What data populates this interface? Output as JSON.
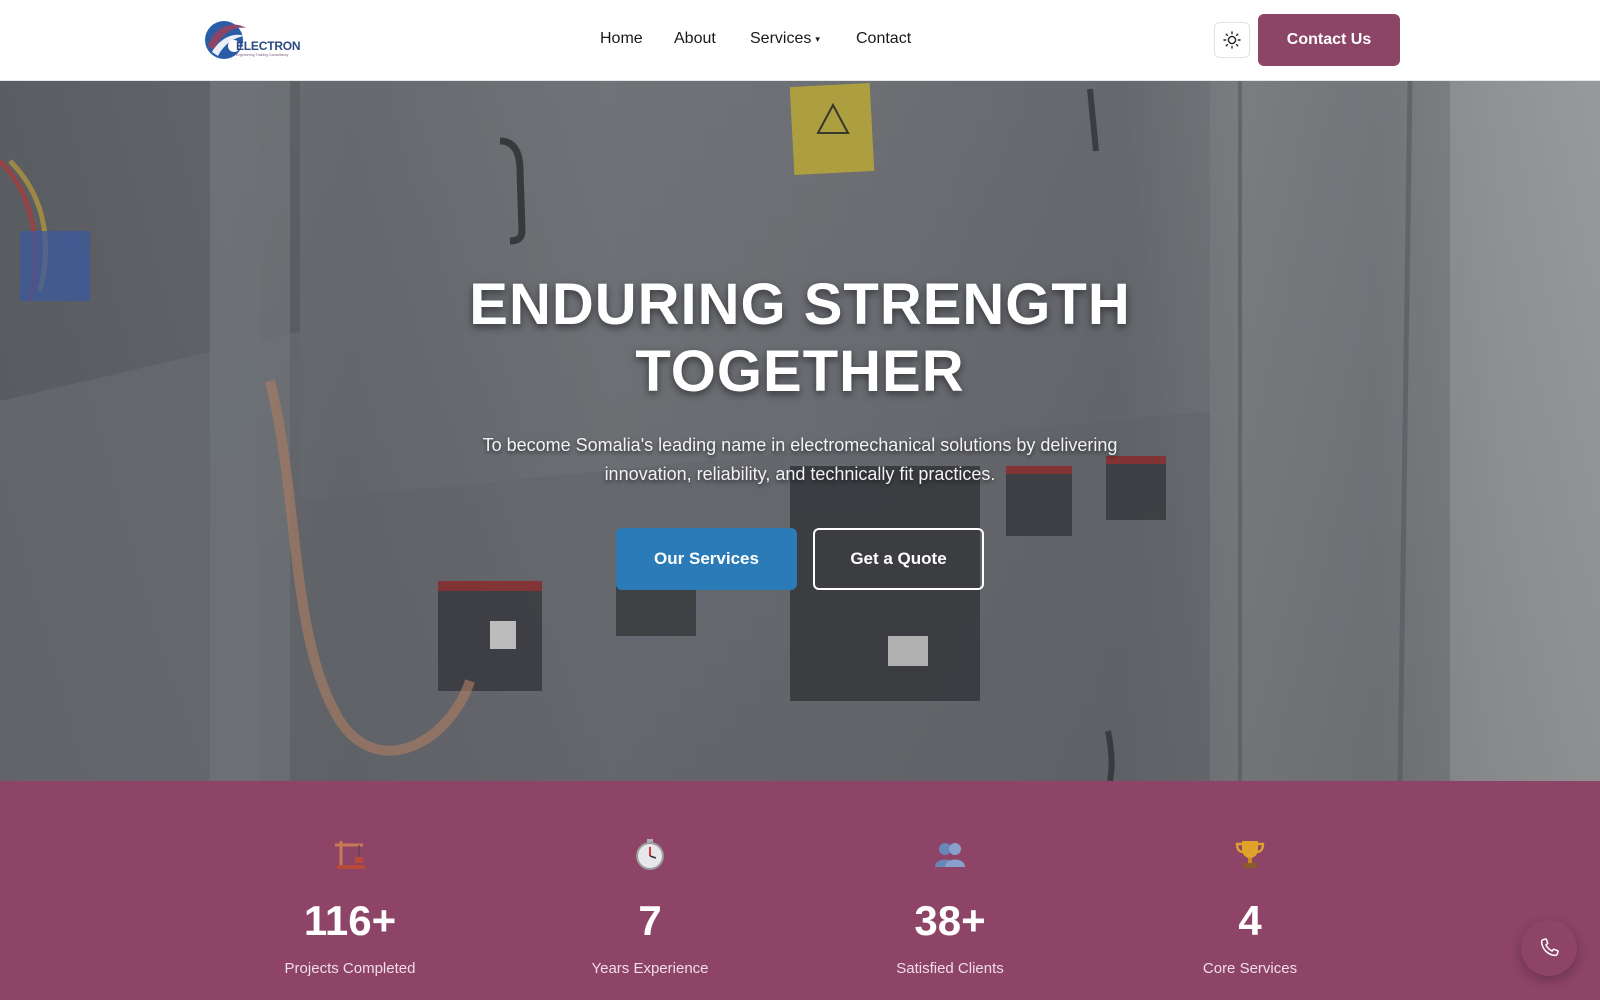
{
  "brand": {
    "name": "ELECTRON",
    "tagline": "Engineering Training Consultancy",
    "colors": {
      "primary": "#8c4467",
      "accent_blue": "#2b7bb9"
    }
  },
  "nav": {
    "items": [
      {
        "label": "Home"
      },
      {
        "label": "About"
      },
      {
        "label": "Services",
        "has_dropdown": true,
        "caret": "▾"
      },
      {
        "label": "Contact"
      }
    ],
    "theme_toggle_icon": "sun-icon",
    "cta_label": "Contact Us"
  },
  "hero": {
    "title": "ENDURING STRENGTH TOGETHER",
    "subtitle": "To become Somalia's leading name in electromechanical solutions by delivering innovation, reliability, and technically fit practices.",
    "primary_button": "Our Services",
    "secondary_button": "Get a Quote"
  },
  "stats": [
    {
      "icon": "construction-crane-icon",
      "value": "116+",
      "label": "Projects Completed"
    },
    {
      "icon": "stopwatch-icon",
      "value": "7",
      "label": "Years Experience"
    },
    {
      "icon": "people-icon",
      "value": "38+",
      "label": "Satisfied Clients"
    },
    {
      "icon": "trophy-icon",
      "value": "4",
      "label": "Core Services"
    }
  ],
  "floating": {
    "icon": "phone-icon"
  }
}
